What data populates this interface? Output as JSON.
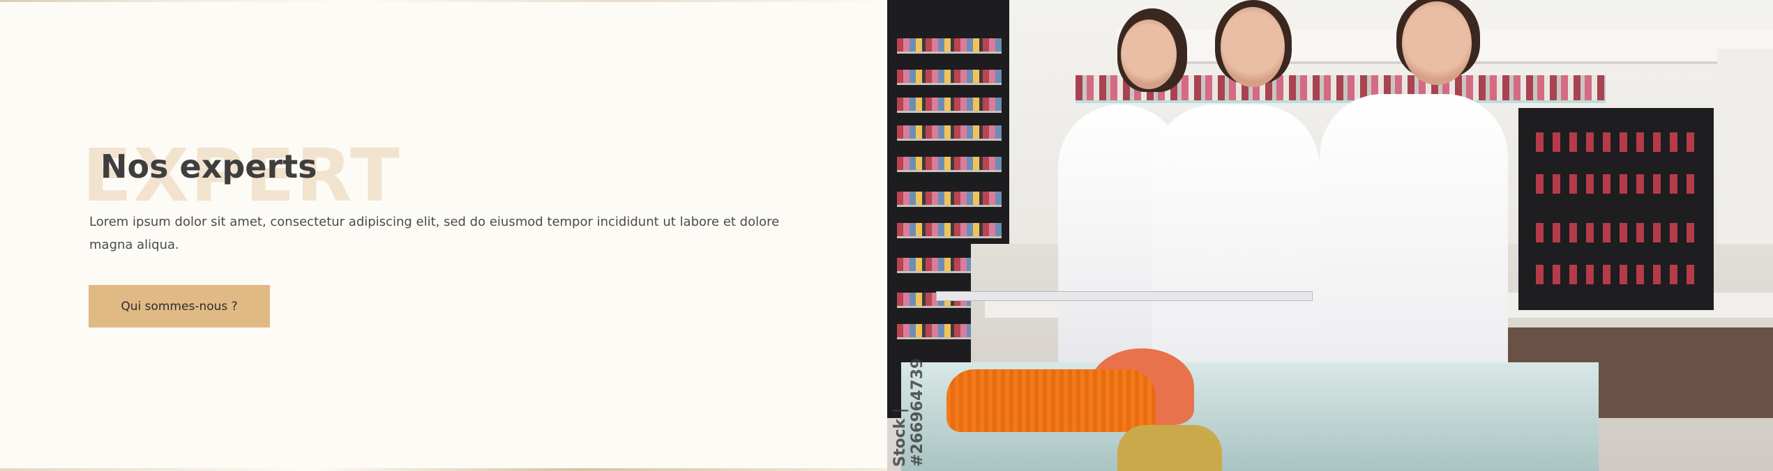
{
  "section": {
    "background_word": "EXPERT",
    "title": "Nos experts",
    "description": "Lorem ipsum dolor sit amet, consectetur adipiscing elit, sed do eiusmod tempor incididunt ut labore et dolore magna aliqua.",
    "cta_label": "Qui sommes-nous ?"
  },
  "image": {
    "watermark": "Stock | #266964739"
  },
  "colors": {
    "page_background": "#fdfbf6",
    "accent": "#e0b985",
    "background_word": "#f2e3cf",
    "title": "#3e3e3e"
  }
}
